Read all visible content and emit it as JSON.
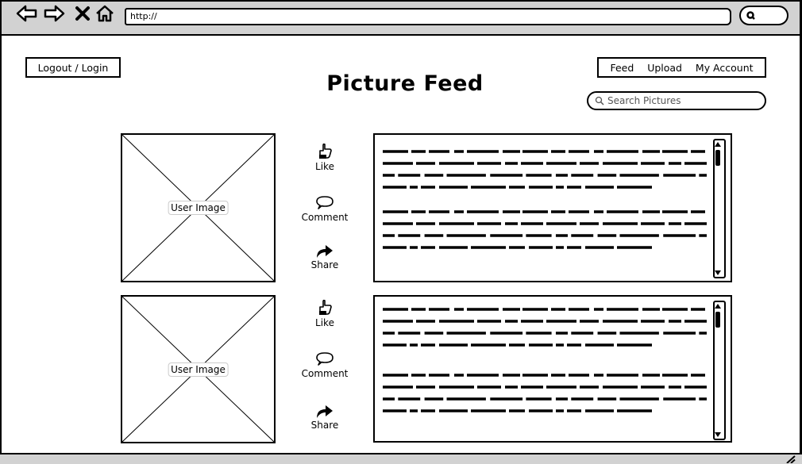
{
  "browser": {
    "url": "http://",
    "nav_icons": [
      "back-arrow-icon",
      "forward-arrow-icon",
      "close-x-icon",
      "home-icon"
    ],
    "search_icon": "search-icon"
  },
  "header": {
    "login_label": "Logout / Login",
    "title": "Picture Feed",
    "nav": [
      "Feed",
      "Upload",
      "My Account"
    ],
    "search_placeholder": "Search Pictures"
  },
  "posts": [
    {
      "image_label": "User Image",
      "actions": [
        {
          "label": "Like",
          "icon": "thumbs-up-icon"
        },
        {
          "label": "Comment",
          "icon": "comment-bubble-icon"
        },
        {
          "label": "Share",
          "icon": "share-arrow-icon"
        }
      ]
    },
    {
      "image_label": "User Image",
      "actions": [
        {
          "label": "Like",
          "icon": "thumbs-up-icon"
        },
        {
          "label": "Comment",
          "icon": "comment-bubble-icon"
        },
        {
          "label": "Share",
          "icon": "share-arrow-icon"
        }
      ]
    }
  ]
}
